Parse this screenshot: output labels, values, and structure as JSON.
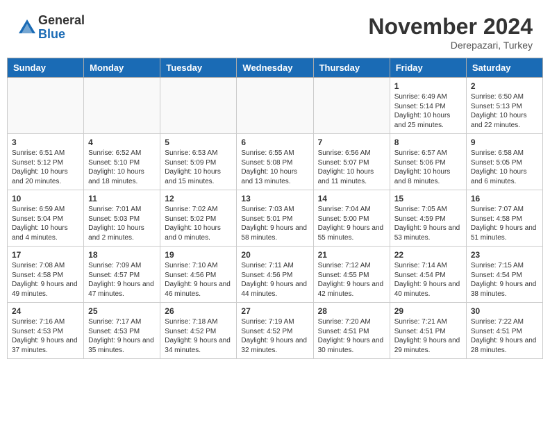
{
  "header": {
    "logo": {
      "general": "General",
      "blue": "Blue"
    },
    "title": "November 2024",
    "subtitle": "Derepazari, Turkey"
  },
  "calendar": {
    "weekdays": [
      "Sunday",
      "Monday",
      "Tuesday",
      "Wednesday",
      "Thursday",
      "Friday",
      "Saturday"
    ],
    "weeks": [
      [
        {
          "day": "",
          "info": ""
        },
        {
          "day": "",
          "info": ""
        },
        {
          "day": "",
          "info": ""
        },
        {
          "day": "",
          "info": ""
        },
        {
          "day": "",
          "info": ""
        },
        {
          "day": "1",
          "info": "Sunrise: 6:49 AM\nSunset: 5:14 PM\nDaylight: 10 hours and 25 minutes."
        },
        {
          "day": "2",
          "info": "Sunrise: 6:50 AM\nSunset: 5:13 PM\nDaylight: 10 hours and 22 minutes."
        }
      ],
      [
        {
          "day": "3",
          "info": "Sunrise: 6:51 AM\nSunset: 5:12 PM\nDaylight: 10 hours and 20 minutes."
        },
        {
          "day": "4",
          "info": "Sunrise: 6:52 AM\nSunset: 5:10 PM\nDaylight: 10 hours and 18 minutes."
        },
        {
          "day": "5",
          "info": "Sunrise: 6:53 AM\nSunset: 5:09 PM\nDaylight: 10 hours and 15 minutes."
        },
        {
          "day": "6",
          "info": "Sunrise: 6:55 AM\nSunset: 5:08 PM\nDaylight: 10 hours and 13 minutes."
        },
        {
          "day": "7",
          "info": "Sunrise: 6:56 AM\nSunset: 5:07 PM\nDaylight: 10 hours and 11 minutes."
        },
        {
          "day": "8",
          "info": "Sunrise: 6:57 AM\nSunset: 5:06 PM\nDaylight: 10 hours and 8 minutes."
        },
        {
          "day": "9",
          "info": "Sunrise: 6:58 AM\nSunset: 5:05 PM\nDaylight: 10 hours and 6 minutes."
        }
      ],
      [
        {
          "day": "10",
          "info": "Sunrise: 6:59 AM\nSunset: 5:04 PM\nDaylight: 10 hours and 4 minutes."
        },
        {
          "day": "11",
          "info": "Sunrise: 7:01 AM\nSunset: 5:03 PM\nDaylight: 10 hours and 2 minutes."
        },
        {
          "day": "12",
          "info": "Sunrise: 7:02 AM\nSunset: 5:02 PM\nDaylight: 10 hours and 0 minutes."
        },
        {
          "day": "13",
          "info": "Sunrise: 7:03 AM\nSunset: 5:01 PM\nDaylight: 9 hours and 58 minutes."
        },
        {
          "day": "14",
          "info": "Sunrise: 7:04 AM\nSunset: 5:00 PM\nDaylight: 9 hours and 55 minutes."
        },
        {
          "day": "15",
          "info": "Sunrise: 7:05 AM\nSunset: 4:59 PM\nDaylight: 9 hours and 53 minutes."
        },
        {
          "day": "16",
          "info": "Sunrise: 7:07 AM\nSunset: 4:58 PM\nDaylight: 9 hours and 51 minutes."
        }
      ],
      [
        {
          "day": "17",
          "info": "Sunrise: 7:08 AM\nSunset: 4:58 PM\nDaylight: 9 hours and 49 minutes."
        },
        {
          "day": "18",
          "info": "Sunrise: 7:09 AM\nSunset: 4:57 PM\nDaylight: 9 hours and 47 minutes."
        },
        {
          "day": "19",
          "info": "Sunrise: 7:10 AM\nSunset: 4:56 PM\nDaylight: 9 hours and 46 minutes."
        },
        {
          "day": "20",
          "info": "Sunrise: 7:11 AM\nSunset: 4:56 PM\nDaylight: 9 hours and 44 minutes."
        },
        {
          "day": "21",
          "info": "Sunrise: 7:12 AM\nSunset: 4:55 PM\nDaylight: 9 hours and 42 minutes."
        },
        {
          "day": "22",
          "info": "Sunrise: 7:14 AM\nSunset: 4:54 PM\nDaylight: 9 hours and 40 minutes."
        },
        {
          "day": "23",
          "info": "Sunrise: 7:15 AM\nSunset: 4:54 PM\nDaylight: 9 hours and 38 minutes."
        }
      ],
      [
        {
          "day": "24",
          "info": "Sunrise: 7:16 AM\nSunset: 4:53 PM\nDaylight: 9 hours and 37 minutes."
        },
        {
          "day": "25",
          "info": "Sunrise: 7:17 AM\nSunset: 4:53 PM\nDaylight: 9 hours and 35 minutes."
        },
        {
          "day": "26",
          "info": "Sunrise: 7:18 AM\nSunset: 4:52 PM\nDaylight: 9 hours and 34 minutes."
        },
        {
          "day": "27",
          "info": "Sunrise: 7:19 AM\nSunset: 4:52 PM\nDaylight: 9 hours and 32 minutes."
        },
        {
          "day": "28",
          "info": "Sunrise: 7:20 AM\nSunset: 4:51 PM\nDaylight: 9 hours and 30 minutes."
        },
        {
          "day": "29",
          "info": "Sunrise: 7:21 AM\nSunset: 4:51 PM\nDaylight: 9 hours and 29 minutes."
        },
        {
          "day": "30",
          "info": "Sunrise: 7:22 AM\nSunset: 4:51 PM\nDaylight: 9 hours and 28 minutes."
        }
      ]
    ]
  }
}
